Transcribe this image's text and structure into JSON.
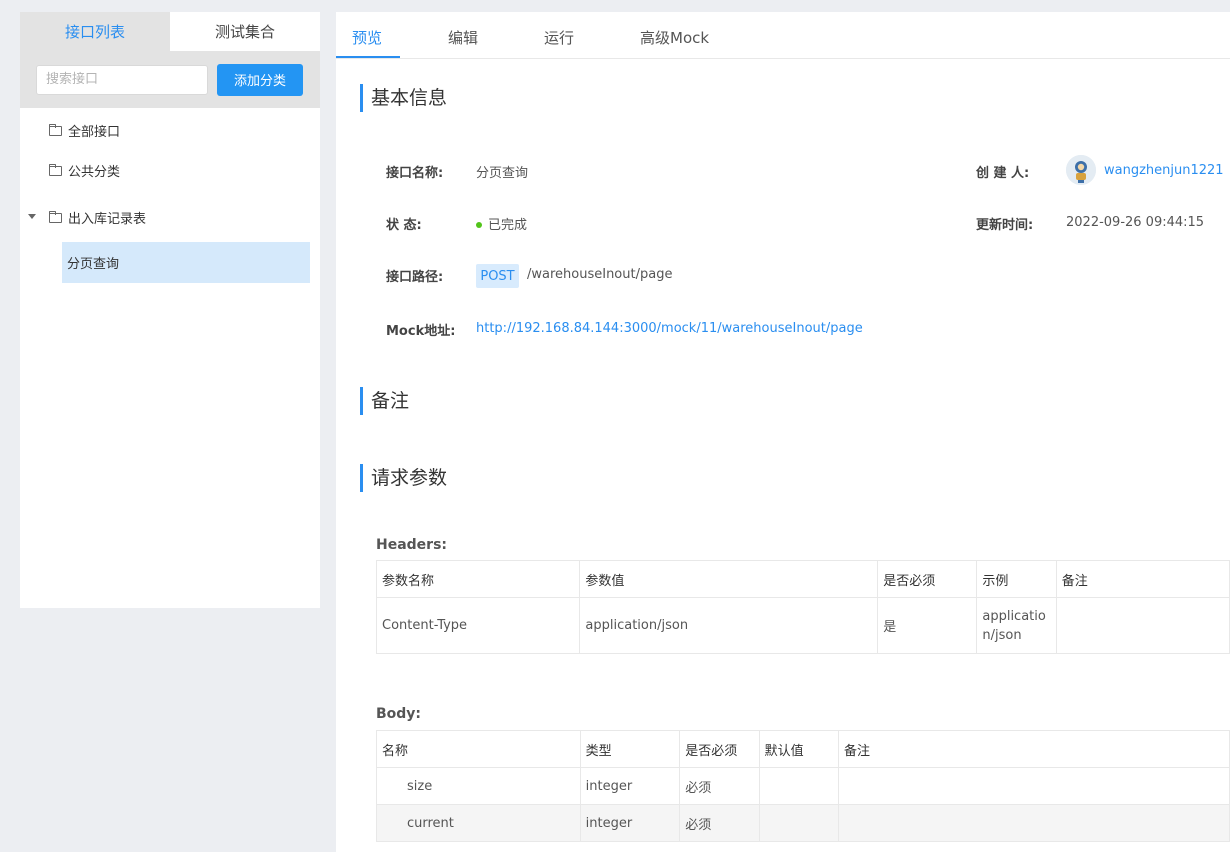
{
  "sidebar": {
    "tabs": [
      {
        "label": "接口列表",
        "active": true
      },
      {
        "label": "测试集合",
        "active": false
      }
    ],
    "search": {
      "placeholder": "搜索接口",
      "value": ""
    },
    "add_category_label": "添加分类",
    "tree": [
      {
        "label": "全部接口",
        "icon": "folder-icon"
      },
      {
        "label": "公共分类",
        "icon": "folder-icon"
      },
      {
        "label": "出入库记录表",
        "icon": "folder-icon",
        "expanded": true,
        "children": [
          {
            "label": "分页查询",
            "selected": true
          }
        ]
      }
    ]
  },
  "tabs": [
    {
      "label": "预览",
      "active": true
    },
    {
      "label": "编辑",
      "active": false
    },
    {
      "label": "运行",
      "active": false
    },
    {
      "label": "高级Mock",
      "active": false
    }
  ],
  "basic_info": {
    "title": "基本信息",
    "name_label": "接口名称:",
    "name_value": "分页查询",
    "creator_label": "创  建  人:",
    "creator_value": "wangzhenjun1221",
    "status_label": "状      态:",
    "status_value": "已完成",
    "status_color": "#52c41a",
    "updated_label": "更新时间:",
    "updated_value": "2022-09-26 09:44:15",
    "path_label": "接口路径:",
    "method": "POST",
    "path_value": "/warehouseInout/page",
    "mock_label": "Mock地址:",
    "mock_value": "http://192.168.84.144:3000/mock/11/warehouseInout/page"
  },
  "remark_title": "备注",
  "request_params": {
    "title": "请求参数",
    "headers_title": "Headers:",
    "headers_columns": [
      "参数名称",
      "参数值",
      "是否必须",
      "示例",
      "备注"
    ],
    "headers_rows": [
      [
        "Content-Type",
        "application/json",
        "是",
        "application/json",
        ""
      ]
    ],
    "body_title": "Body:",
    "body_columns": [
      "名称",
      "类型",
      "是否必须",
      "默认值",
      "备注"
    ],
    "body_rows": [
      [
        "size",
        "integer",
        "必须",
        "",
        ""
      ],
      [
        "current",
        "integer",
        "必须",
        "",
        ""
      ]
    ]
  },
  "colors": {
    "accent": "#2a8ef0",
    "button": "#2395f3",
    "selected_bg": "#d5e9fb",
    "badge_bg": "#d8ebfd"
  }
}
